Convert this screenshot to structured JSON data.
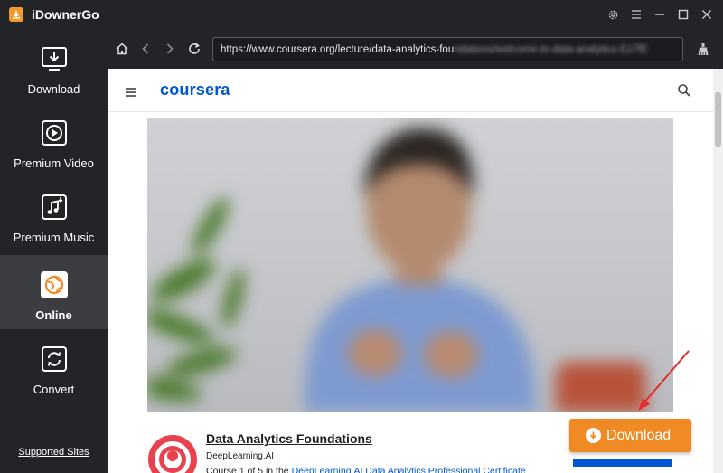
{
  "app": {
    "title": "iDownerGo",
    "accent": "#f39a2c",
    "window_controls": [
      "settings-icon",
      "menu-icon",
      "minimize-icon",
      "maximize-icon",
      "close-icon"
    ]
  },
  "sidebar": {
    "items": [
      {
        "label": "Download",
        "icon": "download-icon"
      },
      {
        "label": "Premium Video",
        "icon": "play-icon"
      },
      {
        "label": "Premium Music",
        "icon": "music-download-icon"
      },
      {
        "label": "Online",
        "icon": "globe-icon",
        "active": true
      },
      {
        "label": "Convert",
        "icon": "convert-icon"
      }
    ],
    "supported_sites": "Supported Sites"
  },
  "browser": {
    "url_visible": "https://www.coursera.org/lecture/data-analytics-fou",
    "url_blurred": "ndations/welcome-to-data-analytics-Ez7fE"
  },
  "site": {
    "logo": "coursera",
    "brand_color": "#0056d2"
  },
  "course": {
    "title": "Data Analytics Foundations",
    "org": "DeepLearning.AI",
    "subtitle_prefix": "Course 1 of 5 in the ",
    "subtitle_link": "DeepLearning.AI Data Analytics Professional Certificate"
  },
  "download_button": {
    "label": "Download",
    "color": "#f08a24"
  }
}
